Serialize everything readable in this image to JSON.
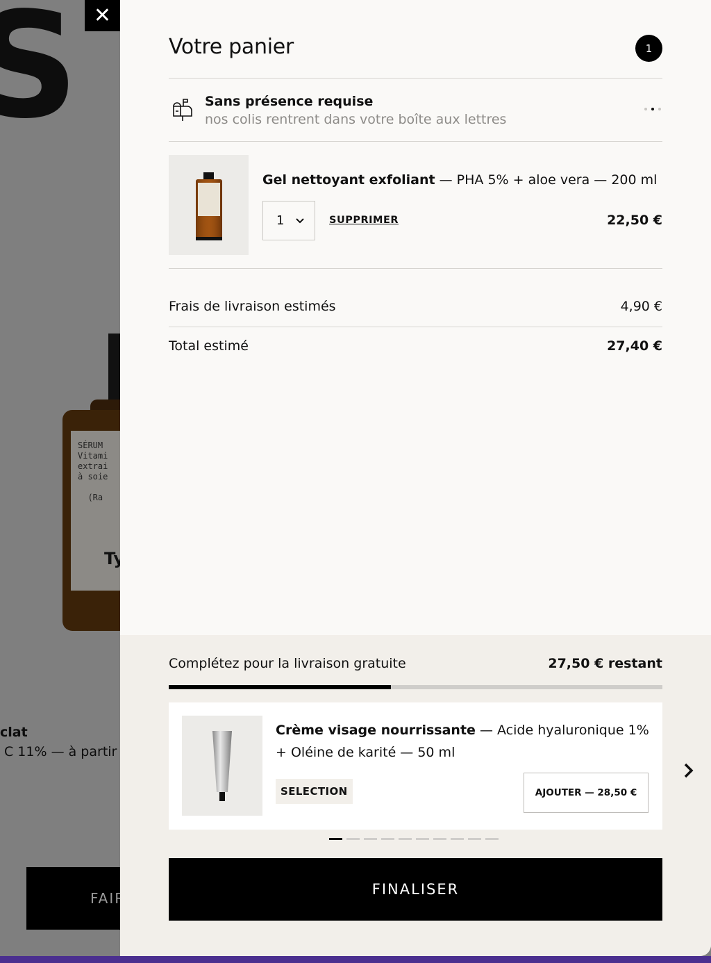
{
  "background": {
    "big_letter": "S",
    "bottle_label_text": "SÉRUM\nVitami\nextrai\nà soie\n\n  (Ra",
    "bottle_brand": "Ty",
    "product_name": "clat",
    "product_desc": "C 11% — à partir",
    "cta_label": "FAIR"
  },
  "close_icon": "✕",
  "cart": {
    "title": "Votre panier",
    "count": "1",
    "notice": {
      "title": "Sans présence requise",
      "subtitle": "nos colis rentrent dans votre boîte aux lettres"
    },
    "item": {
      "name_bold": "Gel nettoyant exfoliant",
      "name_rest": " — PHA 5% + aloe vera — 200 ml",
      "quantity": "1",
      "remove_label": "SUPPRIMER",
      "price": "22,50 €"
    },
    "shipping": {
      "label": "Frais de livraison estimés",
      "value": "4,90 €"
    },
    "total": {
      "label": "Total estimé",
      "value": "27,40 €"
    }
  },
  "free_shipping": {
    "label": "Complétez pour la livraison gratuite",
    "remaining": "27,50 € restant",
    "progress_fraction": 0.45
  },
  "recommendation": {
    "name_bold": "Crème visage nourrissante",
    "name_rest": " — Acide hyaluronique 1% + Oléine de karité — 50 ml",
    "badge": "SELECTION",
    "add_label": "AJOUTER — 28,50 €"
  },
  "carousel": {
    "count": 10,
    "active": 0
  },
  "checkout_label": "FINALISER",
  "colors": {
    "accent": "#000000",
    "panel_bg": "#faf9f7",
    "bottom_bg": "#f2efea",
    "overlay": "#7f7f7f"
  }
}
